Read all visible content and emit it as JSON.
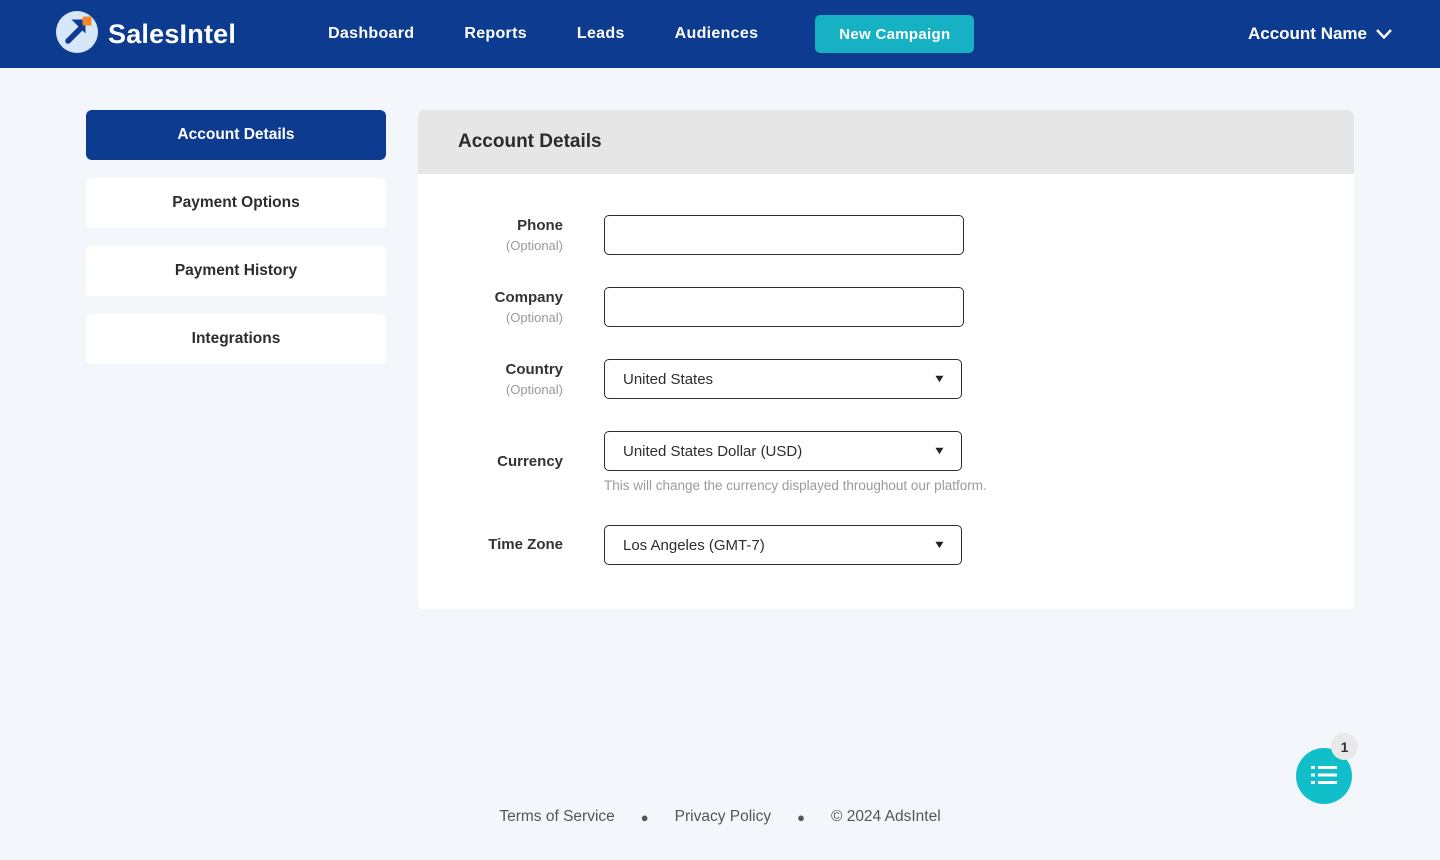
{
  "navbar": {
    "brand": "SalesIntel",
    "links": [
      {
        "label": "Dashboard"
      },
      {
        "label": "Reports"
      },
      {
        "label": "Leads"
      },
      {
        "label": "Audiences"
      }
    ],
    "new_campaign_label": "New Campaign",
    "account_menu_label": "Account Name"
  },
  "sidebar": {
    "items": [
      {
        "label": "Account Details",
        "active": true
      },
      {
        "label": "Payment Options",
        "active": false
      },
      {
        "label": "Payment History",
        "active": false
      },
      {
        "label": "Integrations",
        "active": false
      }
    ]
  },
  "panel": {
    "title": "Account Details",
    "fields": {
      "phone": {
        "label": "Phone",
        "optional": "(Optional)",
        "value": ""
      },
      "company": {
        "label": "Company",
        "optional": "(Optional)",
        "value": ""
      },
      "country": {
        "label": "Country",
        "optional": "(Optional)",
        "value": "United States"
      },
      "currency": {
        "label": "Currency",
        "value": "United States Dollar (USD)",
        "helper": "This will change the currency displayed throughout our platform."
      },
      "timezone": {
        "label": "Time Zone",
        "value": "Los Angeles (GMT-7)"
      }
    }
  },
  "footer": {
    "terms": "Terms of Service",
    "privacy": "Privacy Policy",
    "copyright": "© 2024 AdsIntel"
  },
  "chat": {
    "badge": "1"
  },
  "colors": {
    "navbar_blue": "#0d3b8f",
    "teal_button": "#17b1c4",
    "chat_teal": "#10bfc9",
    "header_gray": "#e6e6e6",
    "page_bg": "#f3f7fc",
    "logo_orange": "#f5862e"
  }
}
